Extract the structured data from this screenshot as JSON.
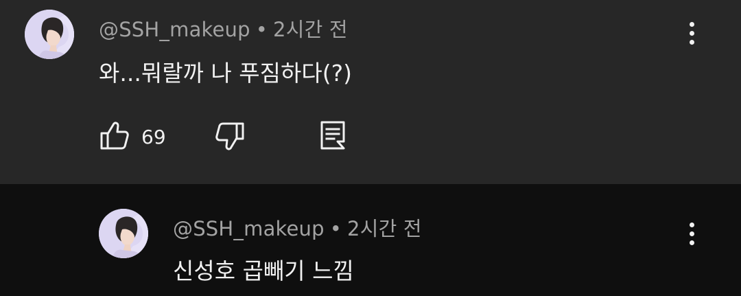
{
  "comments": [
    {
      "author": "@SSH_makeup",
      "separator": "•",
      "time": "2시간 전",
      "text": "와...뭐랄까 나 푸짐하다(?)",
      "like_count": "69",
      "icons": [
        "thumbs-up-icon",
        "thumbs-down-icon",
        "reply-icon",
        "more-vert-icon"
      ]
    },
    {
      "author": "@SSH_makeup",
      "separator": "•",
      "time": "2시간 전",
      "text": "신성호 곱빼기 느낌",
      "icons": [
        "more-vert-icon"
      ]
    }
  ],
  "colors": {
    "top_background": "#272727",
    "reply_background": "#0f0f0f",
    "meta_text": "#a3a3a3",
    "body_text": "#f1f1f1"
  }
}
